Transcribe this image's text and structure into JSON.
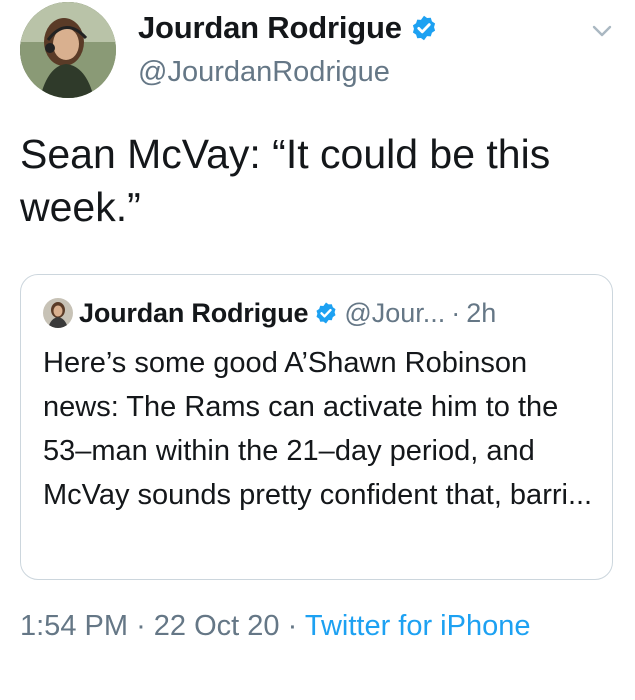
{
  "author": {
    "display_name": "Jourdan Rodrigue",
    "handle": "@JourdanRodrigue",
    "verified": true
  },
  "tweet": {
    "text": "Sean McVay: “It could be this week.”"
  },
  "quoted_tweet": {
    "display_name": "Jourdan Rodrigue",
    "handle": "@Jour...",
    "separator": "·",
    "time": "2h",
    "text": "Here’s some good A’Shawn Robinson news: The Rams can activate him to the 53–man within the 21–day period, and McVay sounds pretty confident that, barri..."
  },
  "meta": {
    "time": "1:54 PM",
    "separator": "·",
    "date": "22 Oct 20",
    "source": "Twitter for iPhone"
  },
  "icons": {
    "verified": "verified-badge-icon",
    "menu": "chevron-down-icon"
  },
  "colors": {
    "accent": "#1da1f2",
    "secondary_text": "#657786",
    "primary_text": "#14171a",
    "border": "#ccd6dd"
  }
}
